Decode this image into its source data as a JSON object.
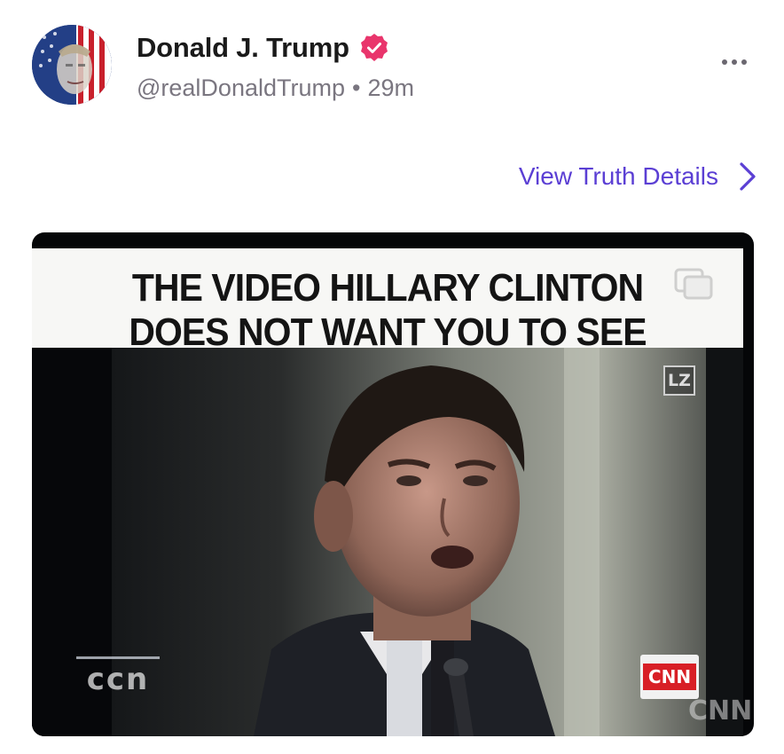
{
  "post": {
    "author_name": "Donald J. Trump",
    "handle": "@realDonaldTrump",
    "separator": "•",
    "time_ago": "29m",
    "verified": true,
    "view_details_label": "View Truth Details"
  },
  "media": {
    "caption_line1": "THE VIDEO HILLARY CLINTON",
    "caption_line2": "DOES NOT WANT YOU TO SEE",
    "corner_badge": "LZ",
    "network_logo": "CNN",
    "ccn_text": "ccn",
    "cnn_watermark": "CNN"
  },
  "icons": {
    "verified": "verified-badge-icon",
    "more": "more-options-icon",
    "chevron": "chevron-right-icon",
    "copy": "copy-icon"
  },
  "colors": {
    "accent": "#5b3fd4",
    "verified_badge": "#e9356c",
    "text_primary": "#1a1a1a",
    "text_secondary": "#7a7680"
  }
}
